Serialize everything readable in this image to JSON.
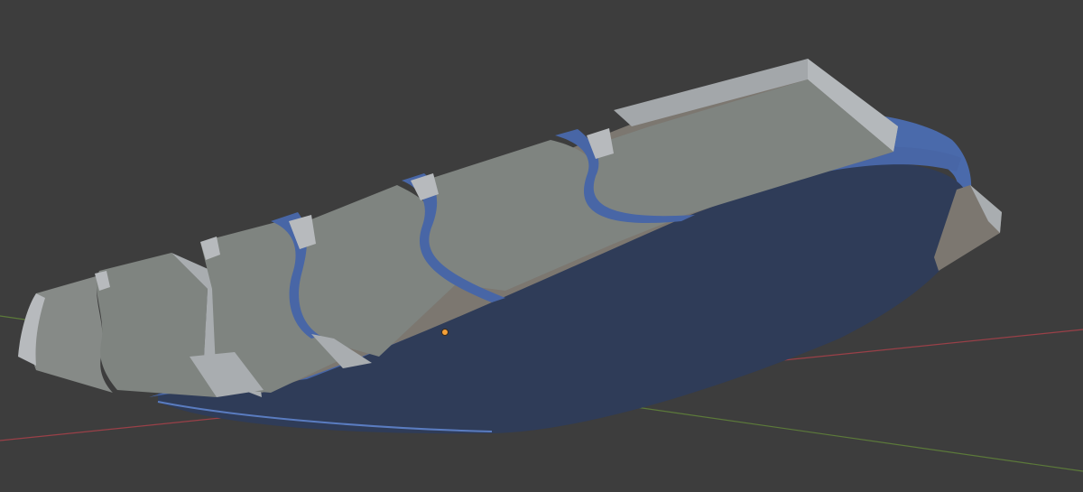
{
  "viewport": {
    "background": "#3d3d3d",
    "axes": {
      "x_axis_color": "#9a4048",
      "y_axis_color": "#5c7a3a"
    },
    "object_origin_color": "#f5a038",
    "model": {
      "base_color": "#3c5ba0",
      "base_dark": "#2e3b56",
      "plank_top": "#7f8480",
      "plank_light": "#a9adb0",
      "plank_side": "#7c7770",
      "plank_edge": "#b7babd"
    }
  }
}
